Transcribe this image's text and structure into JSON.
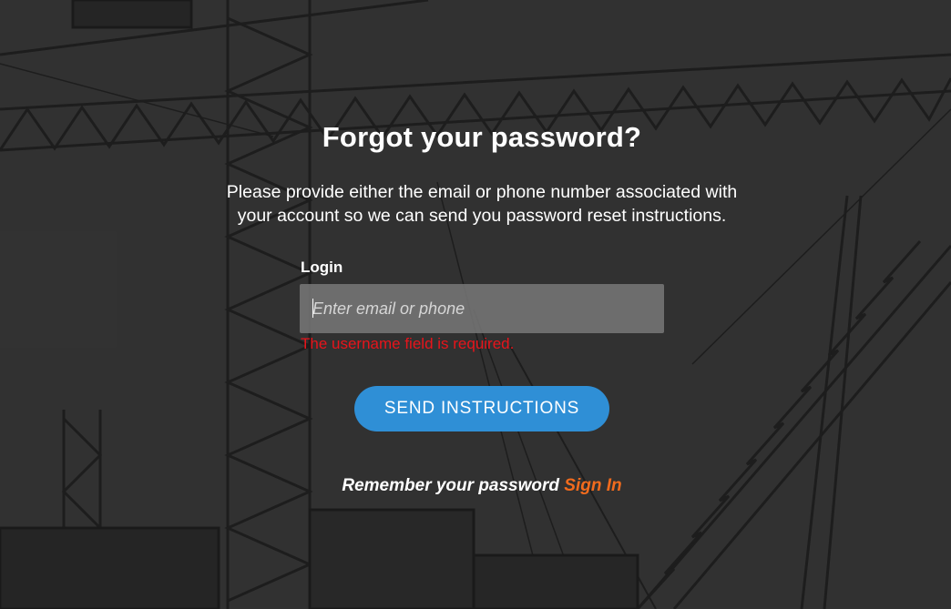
{
  "page": {
    "title": "Forgot your password?",
    "description": "Please provide either the email or phone number associated with your account so we can send you password reset instructions."
  },
  "form": {
    "login_label": "Login",
    "login_placeholder": "Enter email or phone",
    "login_value": "",
    "error_text": "The username field is required.",
    "send_button_label": "SEND INSTRUCTIONS"
  },
  "footer": {
    "remember_text": "Remember your password",
    "signin_label": "Sign In"
  },
  "colors": {
    "accent_button": "#2f8fd6",
    "link": "#f26b1d",
    "error": "#e8141b",
    "text": "#ffffff"
  }
}
